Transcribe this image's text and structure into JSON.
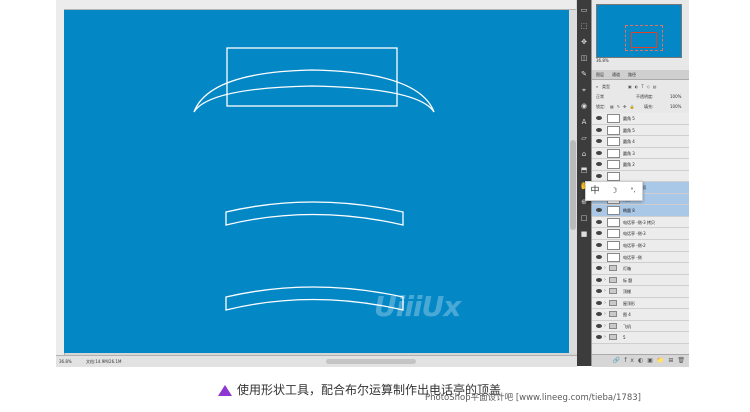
{
  "canvas": {
    "background": "#0487c5",
    "logo_text": "UiiiUx"
  },
  "statusbar": {
    "zoom": "36.8%",
    "doc": "文档:14.9M/26.1M"
  },
  "navigator": {
    "zoom": "36.8%"
  },
  "panel": {
    "tabs": [
      "图层",
      "通道",
      "路径"
    ],
    "kind_label": "类型",
    "blend_mode": "正常",
    "opacity_label": "不透明度:",
    "opacity": "100%",
    "lock_label": "锁定:",
    "fill_label": "填充:",
    "fill": "100%"
  },
  "tools": [
    "▭",
    "⬚",
    "✥",
    "◫",
    "✎",
    "⌖",
    "◉",
    "A",
    "▱",
    "⌂",
    "⬒",
    "✋",
    "⊕",
    "□",
    "■"
  ],
  "ime": {
    "lang": "中",
    "mode": "☽",
    "punct": "°,"
  },
  "layers": [
    {
      "name": "圆角 5",
      "type": "shape",
      "selected": false
    },
    {
      "name": "圆角 5",
      "type": "shape",
      "selected": false
    },
    {
      "name": "圆角 4",
      "type": "shape",
      "selected": false
    },
    {
      "name": "圆角 3",
      "type": "shape",
      "selected": false
    },
    {
      "name": "圆角 2",
      "type": "shape",
      "selected": false
    },
    {
      "name": "",
      "type": "shape",
      "selected": false
    },
    {
      "name": "矩形 14 拷贝",
      "type": "shape",
      "selected": true
    },
    {
      "name": "矩形 14",
      "type": "shape",
      "selected": true
    },
    {
      "name": "椭圆 8",
      "type": "shape",
      "selected": true
    },
    {
      "name": "电话亭 -侧-3 拷贝",
      "type": "shape",
      "selected": false
    },
    {
      "name": "电话亭 -侧-3",
      "type": "shape",
      "selected": false
    },
    {
      "name": "电话亭 -侧-2",
      "type": "shape",
      "selected": false
    },
    {
      "name": "电话亭 -侧",
      "type": "shape",
      "selected": false
    },
    {
      "name": "灯箱",
      "type": "folder",
      "selected": false
    },
    {
      "name": "标 题",
      "type": "folder",
      "selected": false
    },
    {
      "name": "顶棚",
      "type": "folder",
      "selected": false
    },
    {
      "name": "屋顶形",
      "type": "folder",
      "selected": false
    },
    {
      "name": "图 4",
      "type": "folder",
      "selected": false
    },
    {
      "name": "飞机",
      "type": "folder",
      "selected": false
    },
    {
      "name": "5",
      "type": "folder",
      "selected": false
    }
  ],
  "caption": {
    "text": "使用形状工具，配合布尔运算制作出电话亭的顶盖",
    "watermark": "PhotoShop平面设计吧 [www.lineeg.com/tieba/1783]"
  }
}
